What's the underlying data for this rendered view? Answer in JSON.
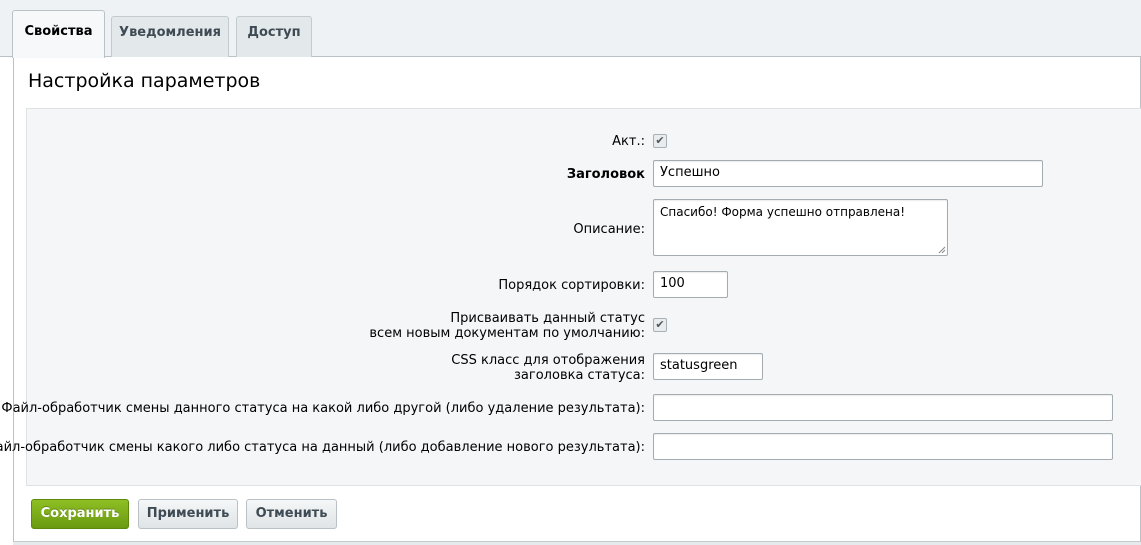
{
  "tabs": [
    {
      "label": "Свойства",
      "active": true
    },
    {
      "label": "Уведомления",
      "active": false
    },
    {
      "label": "Доступ",
      "active": false
    }
  ],
  "page_title": "Настройка параметров",
  "form": {
    "active": {
      "label": "Акт.:",
      "checked": true
    },
    "heading": {
      "label": "Заголовок",
      "value": "Успешно"
    },
    "description": {
      "label": "Описание:",
      "value": "Спасибо! Форма успешно отправлена!"
    },
    "sort": {
      "label": "Порядок сортировки:",
      "value": "100"
    },
    "default_status": {
      "label_line1": "Присваивать данный статус",
      "label_line2": "всем новым документам по умолчанию:",
      "checked": true
    },
    "css_class": {
      "label_line1": "CSS класс для отображения",
      "label_line2": "заголовка статуса:",
      "value": "statusgreen"
    },
    "handler_out": {
      "label": "Файл-обработчик смены данного статуса на какой либо другой (либо удаление результата):",
      "value": ""
    },
    "handler_in": {
      "label": "Файл-обработчик смены какого либо статуса на данный (либо добавление нового результата):",
      "value": ""
    }
  },
  "buttons": {
    "save": "Сохранить",
    "apply": "Применить",
    "cancel": "Отменить"
  },
  "colors": {
    "primary_button": "#7aab16",
    "tab_background": "#eef2f4",
    "form_background": "#f4f6f7"
  },
  "icons": {
    "checkmark": "check-icon"
  }
}
